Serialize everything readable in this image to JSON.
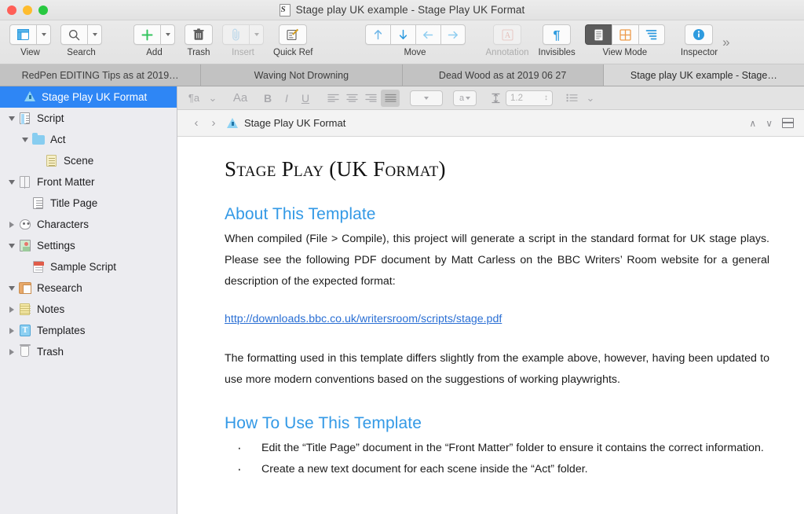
{
  "window": {
    "title": "Stage play UK example - Stage Play UK Format",
    "app_icon": "scrivener-icon",
    "controls": [
      "close",
      "minimize",
      "zoom"
    ]
  },
  "toolbar": {
    "items": [
      {
        "label": "View",
        "icon": "view-layout-icon",
        "has_menu": true,
        "disabled": false
      },
      {
        "label": "Search",
        "icon": "search-icon",
        "has_menu": true,
        "disabled": false
      },
      {
        "label": "Add",
        "icon": "plus-icon",
        "has_menu": true,
        "disabled": false
      },
      {
        "label": "Trash",
        "icon": "trash-icon",
        "has_menu": false,
        "disabled": false
      },
      {
        "label": "Insert",
        "icon": "paperclip-icon",
        "has_menu": true,
        "disabled": true
      },
      {
        "label": "Quick Ref",
        "icon": "quick-reference-icon",
        "has_menu": false,
        "disabled": false
      },
      {
        "label": "Move",
        "icon": "move-arrows-icon",
        "has_menu": false,
        "disabled": false
      },
      {
        "label": "Annotation",
        "icon": "annotation-a-icon",
        "has_menu": false,
        "disabled": true
      },
      {
        "label": "Invisibles",
        "icon": "pilcrow-icon",
        "has_menu": false,
        "disabled": false
      },
      {
        "label": "View Mode",
        "icon": "view-mode-icon",
        "has_menu": false,
        "disabled": false
      },
      {
        "label": "Inspector",
        "icon": "info-icon",
        "has_menu": false,
        "disabled": false
      }
    ],
    "move_arrows": [
      "up",
      "down",
      "left",
      "right"
    ],
    "view_mode_options": [
      "document",
      "corkboard",
      "outline"
    ],
    "view_mode_selected": "document",
    "overflow_label": "»"
  },
  "tabs": [
    {
      "label": "RedPen EDITING Tips as at 2019…",
      "active": false
    },
    {
      "label": "Waving Not Drowning",
      "active": false
    },
    {
      "label": "Dead Wood as at 2019 06 27",
      "active": false
    },
    {
      "label": "Stage play UK example - Stage…",
      "active": true
    }
  ],
  "sidebar": {
    "items": [
      {
        "label": "Stage Play UK Format",
        "icon": "triangle-warning-icon",
        "indent": 1,
        "disclosure": "none",
        "selected": true
      },
      {
        "label": "Script",
        "icon": "script-doc-icon",
        "indent": 0,
        "disclosure": "down",
        "selected": false
      },
      {
        "label": "Act",
        "icon": "folder-icon",
        "indent": 1,
        "disclosure": "down",
        "selected": false
      },
      {
        "label": "Scene",
        "icon": "scene-doc-icon",
        "indent": 2,
        "disclosure": "none",
        "selected": false
      },
      {
        "label": "Front Matter",
        "icon": "front-matter-icon",
        "indent": 0,
        "disclosure": "down",
        "selected": false
      },
      {
        "label": "Title Page",
        "icon": "text-doc-icon",
        "indent": 1,
        "disclosure": "none",
        "selected": false
      },
      {
        "label": "Characters",
        "icon": "mask-icon",
        "indent": 0,
        "disclosure": "right",
        "selected": false
      },
      {
        "label": "Settings",
        "icon": "settings-photo-icon",
        "indent": 0,
        "disclosure": "down",
        "selected": false
      },
      {
        "label": "Sample Script",
        "icon": "pdf-icon",
        "indent": 1,
        "disclosure": "none",
        "selected": false
      },
      {
        "label": "Research",
        "icon": "research-icon",
        "indent": 0,
        "disclosure": "down",
        "selected": false
      },
      {
        "label": "Notes",
        "icon": "notes-icon",
        "indent": 0,
        "disclosure": "right",
        "selected": false
      },
      {
        "label": "Templates",
        "icon": "templates-icon",
        "indent": 0,
        "disclosure": "right",
        "selected": false
      },
      {
        "label": "Trash",
        "icon": "trash-bin-icon",
        "indent": 0,
        "disclosure": "right",
        "selected": false
      }
    ]
  },
  "format_bar": {
    "paragraph_style_icon": "paragraph-style-icon",
    "font_icon": "Aa",
    "bold": "B",
    "italic": "I",
    "underline": "U",
    "align": [
      "align-left",
      "align-center",
      "align-right",
      "align-justify"
    ],
    "align_selected": "align-justify",
    "font_family_value": "",
    "font_color_icon": "a",
    "line_spacing_value": "1.2",
    "list_icon": "bullet-list-icon"
  },
  "doc_header": {
    "back": "‹",
    "forward": "›",
    "icon": "triangle-warning-icon",
    "title": "Stage Play UK Format",
    "scroll_up": "∧",
    "scroll_down": "∨",
    "split_icon": "split-editor-icon"
  },
  "document": {
    "title": "Stage Play (UK Format)",
    "sections": [
      {
        "heading": "About This Template",
        "paragraph": "When compiled (File > Compile), this project will generate a script in the standard format for UK stage plays.  Please see the following PDF document by Matt Carless on the BBC Writers’ Room website for a general description of the expected format:",
        "link": "http://downloads.bbc.co.uk/writersroom/scripts/stage.pdf",
        "paragraph2": "The formatting used in this template differs slightly from the example above, however, having been updated to use more modern conventions based on the suggestions of working playwrights."
      },
      {
        "heading": "How To Use This Template",
        "bullets": [
          "Edit the “Title Page” document in the “Front Matter” folder to ensure it contains the correct information.",
          "Create a new text document for each scene inside the “Act” folder."
        ]
      }
    ]
  },
  "colors": {
    "accent_heading": "#3399e6",
    "link": "#2a6fd4",
    "selection": "#2e86f5",
    "toolbar_bg": "#e6e6e6",
    "sidebar_bg": "#ececf0"
  }
}
